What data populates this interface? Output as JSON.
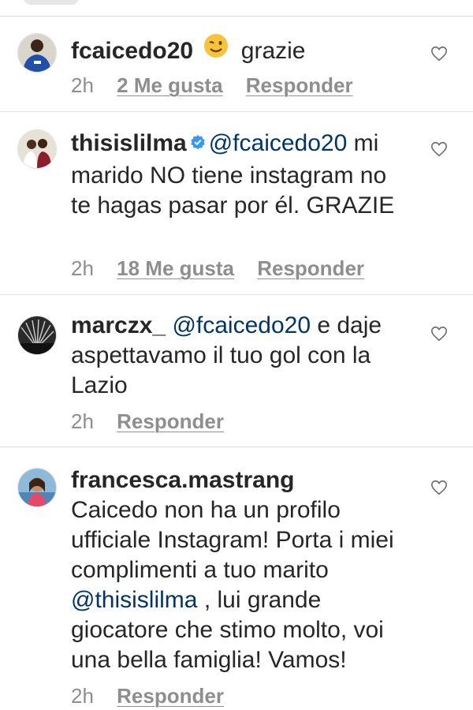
{
  "comments": [
    {
      "username": "fcaicedo20",
      "text": "grazie",
      "has_emoji": true,
      "time": "2h",
      "likes": "2 Me gusta",
      "reply": "Responder"
    },
    {
      "username": "thisislilma",
      "verified": true,
      "mention": "@fcaicedo20",
      "text": " mi marido NO tiene instagram no te hagas pasar por él. GRAZIE",
      "time": "2h",
      "likes": "18 Me gusta",
      "reply": "Responder"
    },
    {
      "username": "marczx_",
      "mention": "@fcaicedo20",
      "text": " e daje aspettavamo il tuo gol con la Lazio",
      "time": "2h",
      "reply": "Responder"
    },
    {
      "username": "francesca.mastrang",
      "text_part1": "Caicedo non ha un profilo ufficiale Instagram! Porta i miei complimenti a tuo marito ",
      "mention": "@thisislilma",
      "text_part2": " , lui grande giocatore che stimo molto, voi una bella famiglia! Vamos!",
      "time": "2h",
      "reply": "Responder"
    }
  ],
  "colors": {
    "username": "#262626",
    "mention": "#003569",
    "meta": "#8e8e8e",
    "verified": "#3897f0"
  },
  "icons": {
    "like": "heart-outline-icon",
    "verified": "verified-badge-icon",
    "emoji": "winking-face-emoji"
  }
}
